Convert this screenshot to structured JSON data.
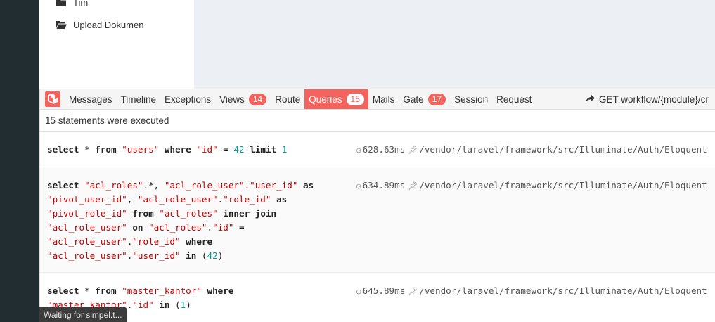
{
  "sidebar": {
    "items": [
      {
        "label": "Tim",
        "icon": "folder-icon"
      },
      {
        "label": "Upload Dokumen",
        "icon": "folder-open-icon"
      }
    ]
  },
  "debugbar": {
    "tabs": [
      {
        "label": "Messages"
      },
      {
        "label": "Timeline"
      },
      {
        "label": "Exceptions"
      },
      {
        "label": "Views",
        "badge": "14"
      },
      {
        "label": "Route"
      },
      {
        "label": "Queries",
        "badge": "15",
        "active": true
      },
      {
        "label": "Mails"
      },
      {
        "label": "Gate",
        "badge": "17"
      },
      {
        "label": "Session"
      },
      {
        "label": "Request"
      }
    ],
    "route": "GET workflow/{module}/cr",
    "status": "15 statements were executed",
    "statements": [
      {
        "time": "628.63ms",
        "source": "/vendor/laravel/framework/src/Illuminate/Auth/Eloquent"
      },
      {
        "time": "634.89ms",
        "source": "/vendor/laravel/framework/src/Illuminate/Auth/Eloquent"
      },
      {
        "time": "645.89ms",
        "source": "/vendor/laravel/framework/src/Illuminate/Auth/Eloquent"
      }
    ]
  },
  "browser_status": "Waiting for simpel.t..."
}
